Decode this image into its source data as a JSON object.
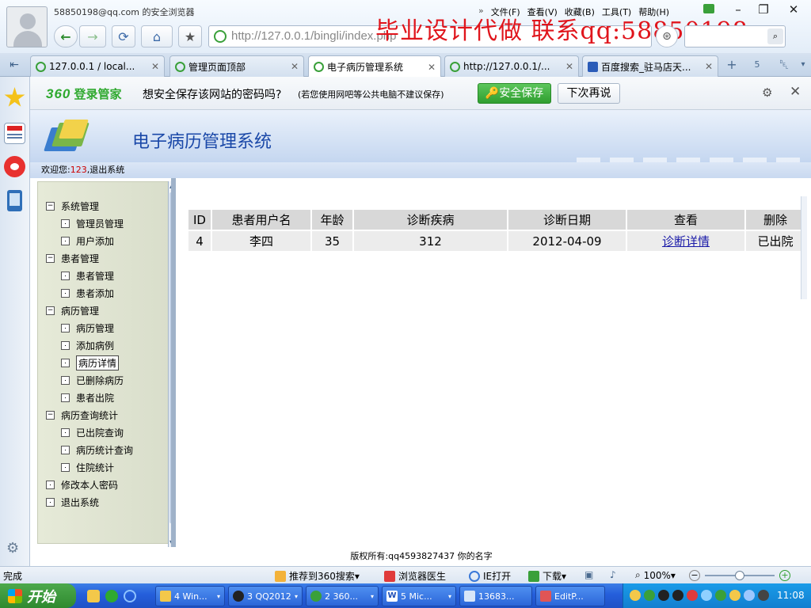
{
  "browser": {
    "user_email": "58850198@qq.com",
    "browser_name": "的安全浏览器",
    "address_url": "http://127.0.0.1/bingli/index.php",
    "menu": [
      "文件(F)",
      "查看(V)",
      "收藏(B)",
      "工具(T)",
      "帮助(H)"
    ],
    "watermark": "毕业设计代做 联系qq:58850198",
    "tabs": [
      {
        "label": "127.0.0.1 / local...",
        "active": false
      },
      {
        "label": "管理页面顶部",
        "active": false
      },
      {
        "label": "电子病历管理系统",
        "active": true
      },
      {
        "label": "http://127.0.0.1/...",
        "active": false
      },
      {
        "label": "百度搜索_驻马店天...",
        "active": false
      }
    ],
    "tab_count": "5"
  },
  "password_bar": {
    "logo_num": "360",
    "logo_text": "登录管家",
    "question": "想安全保存该网站的密码吗?",
    "note": "(若您使用网吧等公共电脑不建议保存)",
    "save_label": "安全保存",
    "later_label": "下次再说"
  },
  "header": {
    "title": "电子病历管理系统",
    "welcome_prefix": "欢迎您:",
    "username": "123",
    "logout": "退出系统"
  },
  "nav": {
    "system": "系统管理",
    "admin_manage": "管理员管理",
    "user_add": "用户添加",
    "patient": "患者管理",
    "patient_manage": "患者管理",
    "patient_add": "患者添加",
    "record": "病历管理",
    "record_manage": "病历管理",
    "record_add": "添加病例",
    "record_detail": "病历详情",
    "record_deleted": "已删除病历",
    "patient_discharge": "患者出院",
    "stats": "病历查询统计",
    "discharged_query": "已出院查询",
    "record_stats": "病历统计查询",
    "inpatient_stats": "住院统计",
    "change_password": "修改本人密码",
    "logout": "退出系统"
  },
  "table": {
    "headers": [
      "ID",
      "患者用户名",
      "年龄",
      "诊断疾病",
      "诊断日期",
      "查看",
      "删除"
    ],
    "rows": [
      {
        "id": "4",
        "username": "李四",
        "age": "35",
        "disease": "312",
        "date": "2012-04-09",
        "view": "诊断详情",
        "status": "已出院"
      }
    ]
  },
  "footer": {
    "copyright": "版权所有:qq4593827437 你的名字"
  },
  "statusbar": {
    "status": "完成",
    "recommend": "推荐到360搜索",
    "doctor": "浏览器医生",
    "ie_open": "IE打开",
    "download": "下载",
    "zoom": "100%",
    "zoom_level": 0.5
  },
  "taskbar": {
    "start": "开始",
    "items": [
      "4 Win...",
      "3 QQ2012",
      "2 360...",
      "5 Mic...",
      "13683...",
      "EditP..."
    ],
    "clock": "11:08"
  },
  "colors": {
    "watermark": "#e0151c",
    "title": "#1a48a8",
    "save_green": "#2f9e2f"
  }
}
